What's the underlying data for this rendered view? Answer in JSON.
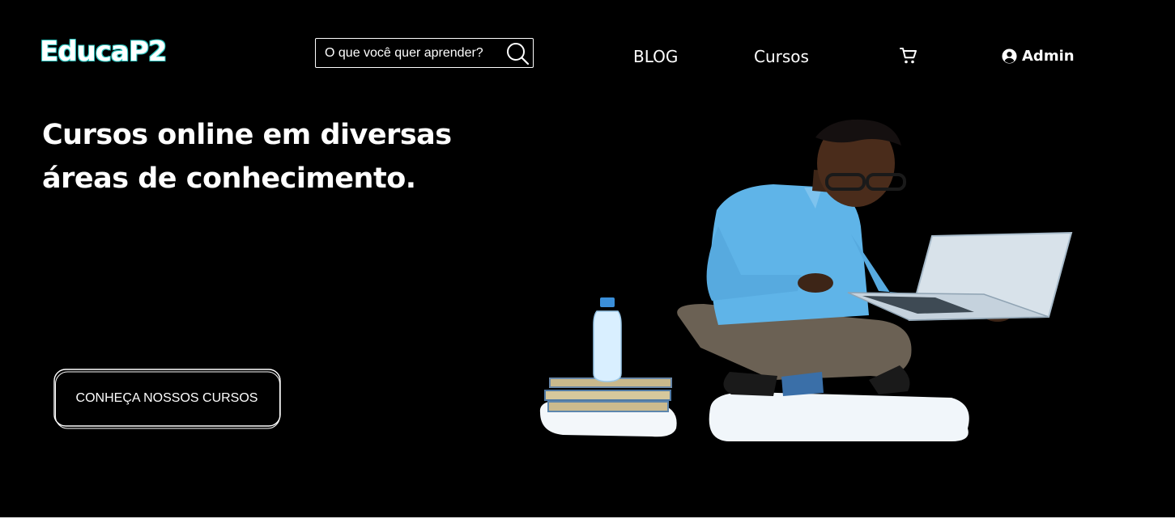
{
  "header": {
    "logo": "EducaP2",
    "search": {
      "placeholder": "O que você quer aprender?",
      "value": ""
    },
    "nav": {
      "blog": "BLOG",
      "cursos": "Cursos"
    },
    "cart_icon": "shopping-cart-icon",
    "user": {
      "icon": "user-circle-icon",
      "label": "Admin"
    }
  },
  "hero": {
    "title": "Cursos online em diversas áreas de conhecimento.",
    "cta_label": "CONHEÇA NOSSOS CURSOS",
    "image": "student-with-laptop-illustration"
  },
  "colors": {
    "background": "#000000",
    "text": "#ffffff",
    "logo_accent": "#2ec7c1",
    "shirt": "#5fb4e8"
  }
}
